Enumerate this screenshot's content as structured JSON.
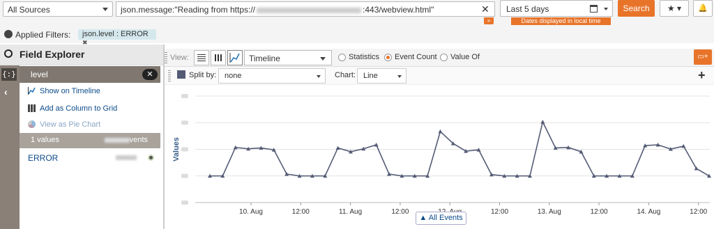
{
  "header": {
    "source": "All Sources",
    "query_prefix": "json.message:\"Reading from https://",
    "query_suffix": ":443/webview.html\"",
    "clear_icon": "close-icon",
    "time_range": "Last 5 days",
    "local_time_note": "Dates displayed in local time",
    "search_label": "Search",
    "favorite_icon": "star-icon",
    "alert_icon": "bell-icon"
  },
  "filters": {
    "label": "Applied Filters:",
    "chips": [
      {
        "text": "json.level : ERROR",
        "remove": "✖"
      }
    ]
  },
  "field_explorer": {
    "title": "Field Explorer",
    "field": "level",
    "actions": [
      "Show on Timeline",
      "Add as Column to Grid",
      "View as Pie Chart"
    ],
    "values_label": "1 values",
    "events_suffix": "vents",
    "value": "ERROR",
    "braces": "{:}",
    "collapse": "‹"
  },
  "toolbar": {
    "view_label": "View:",
    "view_type": "Timeline",
    "radios": [
      {
        "label": "Statistics",
        "selected": false
      },
      {
        "label": "Event Count",
        "selected": true
      },
      {
        "label": "Value Of",
        "selected": false
      }
    ]
  },
  "split": {
    "split_label": "Split by:",
    "split_value": "none",
    "chart_label": "Chart:",
    "chart_value": "Line",
    "add": "+"
  },
  "chart_data": {
    "type": "line",
    "ylabel": "Values",
    "x_ticks": [
      "10. Aug",
      "12:00",
      "11. Aug",
      "12:00",
      "12. Aug",
      "12:00",
      "13. Aug",
      "12:00",
      "14. Aug",
      "12:00"
    ],
    "series": [
      {
        "color": "#545b75",
        "values": [
          0,
          0,
          1.07,
          1.02,
          1.05,
          0.98,
          0.07,
          0,
          0,
          0,
          1.05,
          0.91,
          1.02,
          1.17,
          0.07,
          0,
          0,
          0,
          1.67,
          1.22,
          0.93,
          0.98,
          0.05,
          0,
          0,
          0,
          2.03,
          1.05,
          1.07,
          0.91,
          0,
          0,
          0,
          0,
          1.14,
          1.17,
          1.01,
          1.12,
          0.28,
          0
        ]
      }
    ],
    "ylim": [
      -1,
      3
    ],
    "grid": true
  },
  "footer": {
    "all_events": "▲  All Events"
  }
}
